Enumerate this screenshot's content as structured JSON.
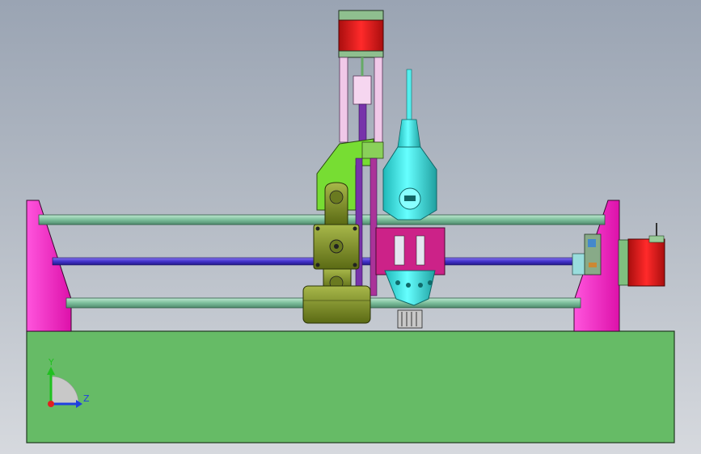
{
  "viewport": {
    "background_top": "#9aa4b3",
    "background_bottom": "#d6d9de"
  },
  "triad": {
    "y_label": "Y",
    "z_label": "Z",
    "x_color": "#e02020",
    "y_color": "#20c020",
    "z_color": "#2040e0"
  },
  "colors": {
    "base": "#66bb66",
    "end_plates": "#ff33cc",
    "rails": "#88ccaa",
    "lead_screw": "#4433cc",
    "motor_red": "#e02020",
    "carriage_olive": "#7a8a20",
    "spindle_cyan": "#33dddd",
    "z_frame_green": "#77dd33",
    "bracket_magenta": "#cc2288",
    "guide_purple": "#7733aa"
  }
}
